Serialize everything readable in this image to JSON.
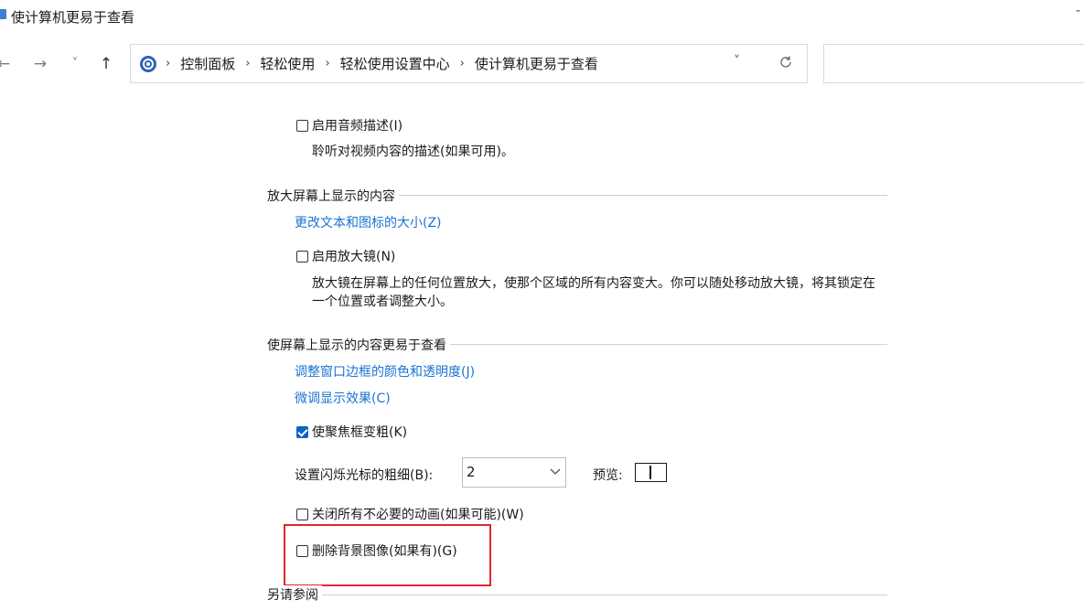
{
  "window": {
    "title": "使计算机更易于查看",
    "control_glyph": "-"
  },
  "nav": {
    "back_glyph": "←",
    "forward_glyph": "→",
    "recent_glyph": "˅",
    "up_glyph": "↑"
  },
  "address_bar": {
    "crumbs": [
      "控制面板",
      "轻松使用",
      "轻松使用设置中心",
      "使计算机更易于查看"
    ],
    "separator": "›",
    "dropdown_glyph": "˅"
  },
  "content": {
    "audio_desc": {
      "label": "启用音频描述(I)",
      "checked": false,
      "description": "聆听对视频内容的描述(如果可用)。"
    },
    "section_magnify": {
      "heading": "放大屏幕上显示的内容",
      "link": "更改文本和图标的大小(Z)"
    },
    "magnifier": {
      "label": "启用放大镜(N)",
      "checked": false,
      "description_line1": "放大镜在屏幕上的任何位置放大，使那个区域的所有内容变大。你可以随处移动放大镜，将其锁定在",
      "description_line2": "一个位置或者调整大小。"
    },
    "section_easier": {
      "heading": "使屏幕上显示的内容更易于查看",
      "link1": "调整窗口边框的颜色和透明度(J)",
      "link2": "微调显示效果(C)"
    },
    "focus_thick": {
      "label": "使聚焦框变粗(K)",
      "checked": true
    },
    "cursor_thickness": {
      "label": "设置闪烁光标的粗细(B):",
      "value": "2",
      "preview_label": "预览:"
    },
    "animations": {
      "label": "关闭所有不必要的动画(如果可能)(W)",
      "checked": false
    },
    "background_images": {
      "label": "删除背景图像(如果有)(G)",
      "checked": false
    },
    "see_also": {
      "heading": "另请参阅"
    }
  },
  "colors": {
    "link": "#1a73d1",
    "checkbox_checked": "#0a64c8",
    "highlight": "#e0262f"
  }
}
